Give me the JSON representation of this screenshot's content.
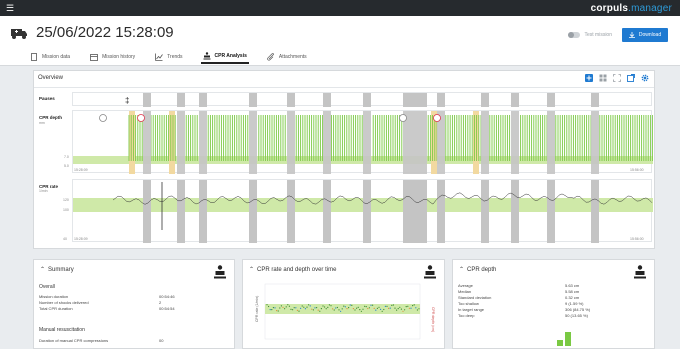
{
  "app": {
    "brand_main": "corpuls",
    "brand_accent": ".manager"
  },
  "header": {
    "datetime": "25/06/2022 15:28:09",
    "test_label": "Test mission",
    "download_label": "Download"
  },
  "tabs": [
    {
      "label": "Mission data",
      "icon": "file-icon"
    },
    {
      "label": "Mission history",
      "icon": "calendar-icon"
    },
    {
      "label": "Trends",
      "icon": "trend-icon"
    },
    {
      "label": "CPR Analysis",
      "icon": "cpr-person-icon",
      "active": true
    },
    {
      "label": "Attachments",
      "icon": "paperclip-icon"
    }
  ],
  "overview": {
    "title": "Overview",
    "tracks": {
      "pauses": {
        "label": "Pauses"
      },
      "depth": {
        "label": "CPR depth",
        "unit": "mm",
        "ticks": [
          "7.0",
          "5.0"
        ]
      },
      "rate": {
        "label": "CPR rate",
        "unit": "1/min",
        "ticks": [
          "120",
          "100",
          "40"
        ]
      }
    },
    "time_start": "15:28:09",
    "time_end": "15:56:00"
  },
  "summary": {
    "title": "Summary",
    "overall_label": "Overall",
    "rows": [
      {
        "key": "Mission duration",
        "value": "00:54:46"
      },
      {
        "key": "Number of shocks delivered",
        "value": "2"
      },
      {
        "key": "Total CPR duration",
        "value": "00:54:54"
      }
    ],
    "manual_label": "Manual resuscitation",
    "manual_rows": [
      {
        "key": "Duration of manual CPR compressions",
        "value": "00"
      }
    ]
  },
  "rate_depth_card": {
    "title": "CPR rate and depth over time",
    "y_left_label": "CPR rate (1/min)",
    "y_right_label": "CPR depth (cm)"
  },
  "depth_card": {
    "title": "CPR depth",
    "stats": [
      {
        "key": "Average",
        "value": "5.63 cm"
      },
      {
        "key": "Median",
        "value": "5.58 cm"
      },
      {
        "key": "Standard deviation",
        "value": "0.32 cm"
      },
      {
        "key": "Too shallow",
        "value": "9 (1.59 %)"
      },
      {
        "key": "In target range",
        "value": "306 (84.75 %)"
      },
      {
        "key": "Too deep",
        "value": "50 (13.65 %)"
      }
    ]
  },
  "colors": {
    "topbar": "#262a2e",
    "accent_blue": "#1f7ad1",
    "cpr_green": "#7ac943",
    "band_green": "#cfe9a8",
    "pause_gray": "#c4c4c4",
    "warn_orange": "#f2d9a0",
    "shock_red": "#e0344d"
  }
}
